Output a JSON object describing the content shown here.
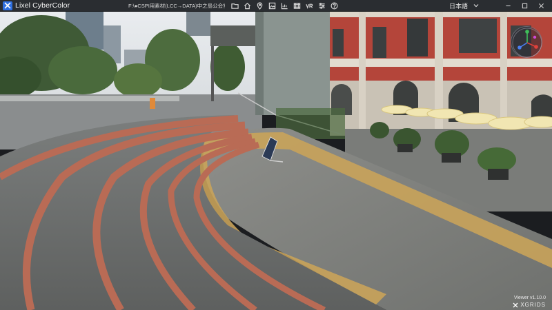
{
  "app": {
    "title": "Lixel CyberColor",
    "file_path": "F:\\●CSPI用素材(LCC→DATA)中之島公会堂\\"
  },
  "toolbar": {
    "icons": [
      "folder-icon",
      "home-icon",
      "location-pin-icon",
      "image-icon",
      "chart-icon",
      "film-icon",
      "vr-icon",
      "sliders-icon",
      "help-icon"
    ]
  },
  "language": {
    "selected": "日本語"
  },
  "viewer": {
    "version": "Viewer v1.10.0",
    "brand": "XGRIDS"
  },
  "gizmo": {
    "axes": {
      "x": "#e0413b",
      "y": "#3fbf5a",
      "z": "#4a7ff0"
    }
  },
  "colors": {
    "titlebar": "#2a2d31",
    "accent": "#2f6fe0"
  }
}
